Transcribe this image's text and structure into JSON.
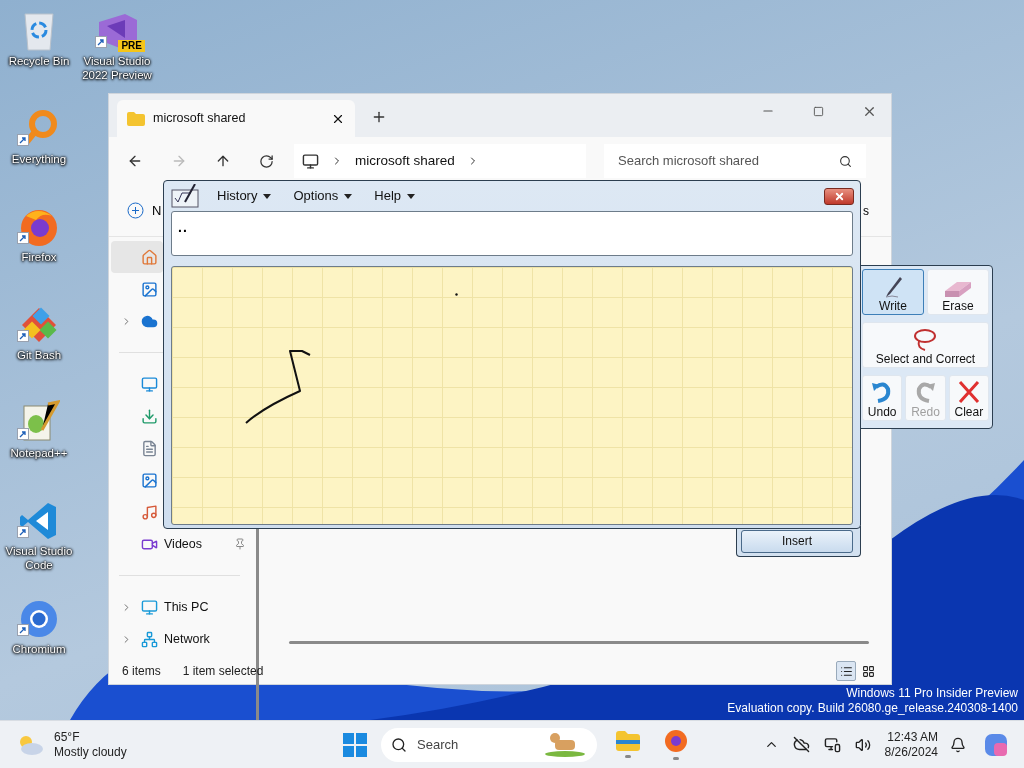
{
  "desktop_icons": [
    {
      "kind": "recycle",
      "label": "Recycle Bin",
      "shortcut": false
    },
    {
      "kind": "vs-preview",
      "label": "Visual Studio 2022 Preview",
      "badge": "PRE",
      "shortcut": true
    },
    {
      "kind": "everything",
      "label": "Everything",
      "shortcut": true
    },
    {
      "kind": "firefox",
      "label": "Firefox",
      "shortcut": true
    },
    {
      "kind": "git",
      "label": "Git Bash",
      "shortcut": true
    },
    {
      "kind": "notepad",
      "label": "Notepad++",
      "shortcut": true
    },
    {
      "kind": "vscode",
      "label": "Visual Studio Code",
      "shortcut": true
    },
    {
      "kind": "chromium",
      "label": "Chromium",
      "shortcut": true
    }
  ],
  "explorer": {
    "tab": {
      "title": "microsoft shared"
    },
    "breadcrumb": [
      "microsoft shared"
    ],
    "search": {
      "placeholder": "Search microsoft shared"
    },
    "command_bar": {
      "new_label": "N",
      "right_text": "s"
    },
    "sidebar": [
      {
        "kind": "home",
        "selected": true
      },
      {
        "kind": "gallery",
        "selected": false
      },
      {
        "kind": "onedrive",
        "expandable": true,
        "selected": false
      },
      {
        "kind": "divider"
      },
      {
        "kind": "desktop",
        "selected": false
      },
      {
        "kind": "downloads",
        "selected": false
      },
      {
        "kind": "documents",
        "selected": false
      },
      {
        "kind": "pictures",
        "selected": false
      },
      {
        "kind": "music",
        "selected": false
      },
      {
        "kind": "videos",
        "label": "Videos",
        "pinned": true,
        "selected": false
      },
      {
        "kind": "divider"
      },
      {
        "kind": "pc",
        "label": "This PC",
        "expandable": true,
        "selected": false
      },
      {
        "kind": "network",
        "label": "Network",
        "expandable": true,
        "selected": false
      }
    ],
    "status_bar": {
      "count": "6 items",
      "selection": "1 item selected"
    },
    "views": [
      {
        "kind": "details",
        "selected": true
      },
      {
        "kind": "tiles",
        "selected": false
      }
    ]
  },
  "math_panel": {
    "menus": [
      "History",
      "Options",
      "Help"
    ],
    "result": "..",
    "insert": "Insert",
    "tools": [
      {
        "kind": "write",
        "label": "Write",
        "selected": true,
        "disabled": false
      },
      {
        "kind": "erase",
        "label": "Erase",
        "selected": false,
        "disabled": false
      },
      {
        "kind": "select",
        "label": "Select and Correct",
        "selected": false,
        "disabled": false
      },
      {
        "kind": "undo",
        "label": "Undo",
        "selected": false,
        "disabled": false
      },
      {
        "kind": "redo",
        "label": "Redo",
        "selected": false,
        "disabled": true
      },
      {
        "kind": "clear",
        "label": "Clear",
        "selected": false,
        "disabled": false
      }
    ]
  },
  "system_notice": [
    "Windows 11 Pro Insider Preview",
    "Evaluation copy. Build 26080.ge_release.240308-1400"
  ],
  "taskbar": {
    "weather": {
      "temp": "65°F",
      "condition": "Mostly cloudy"
    },
    "search": {
      "placeholder": "Search"
    },
    "apps": [
      {
        "kind": "explorer",
        "running": true
      },
      {
        "kind": "firefox",
        "running": true
      }
    ],
    "clock": {
      "time": "12:43 AM",
      "date": "8/26/2024"
    }
  }
}
